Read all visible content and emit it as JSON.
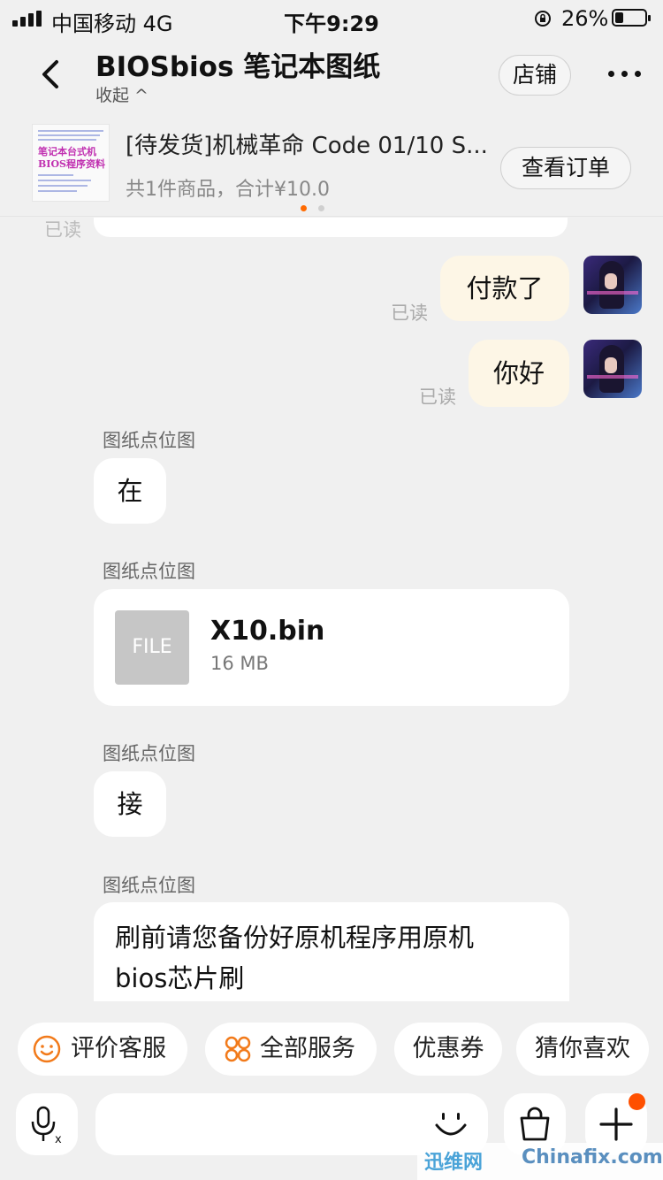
{
  "status_bar": {
    "carrier": "中国移动  4G",
    "time": "下午9:29",
    "battery": "26%",
    "battery_level": 0.26
  },
  "header": {
    "title": "BIOSbios 笔记本图纸",
    "collapse_label": "收起 ^",
    "shop_button": "店铺",
    "more_icon": "more-dots-icon",
    "back_icon": "chevron-left-icon"
  },
  "order": {
    "thumbnail_text_1": "笔记本台式机",
    "thumbnail_text_2": "BIOS程序资料",
    "title": "[待发货]机械革命 Code 01/10 S...",
    "summary": "共1件商品，合计¥10.0",
    "view_button": "查看订单",
    "page_dots": 2,
    "active_dot": 0,
    "accent_color": "#ff6a00"
  },
  "chat": {
    "partial_read": "已读",
    "messages_me": [
      {
        "text": "付款了",
        "read": "已读"
      },
      {
        "text": "你好",
        "read": "已读"
      }
    ],
    "messages_other": [
      {
        "sender": "图纸点位图",
        "text": "在"
      },
      {
        "sender": "图纸点位图",
        "file": {
          "icon_label": "FILE",
          "name": "X10.bin",
          "size": "16 MB"
        }
      },
      {
        "sender": "图纸点位图",
        "text": "接"
      },
      {
        "sender": "图纸点位图",
        "text_line1": "刷前请您备份好原机程序用原机",
        "text_line2": "bios芯片刷"
      }
    ]
  },
  "shortcuts": [
    {
      "label": "评价客服",
      "icon": "smile-icon"
    },
    {
      "label": "全部服务",
      "icon": "services-grid-icon"
    },
    {
      "label": "优惠券"
    },
    {
      "label": "猜你喜欢"
    }
  ],
  "input_bar": {
    "voice_icon": "microphone-icon",
    "emoji_icon": "emoji-icon",
    "bag_icon": "shopping-bag-icon",
    "plus_icon": "plus-icon",
    "badge_color": "#ff5000"
  },
  "watermark": {
    "logo": "迅维网",
    "site": "Chinafix.com"
  }
}
